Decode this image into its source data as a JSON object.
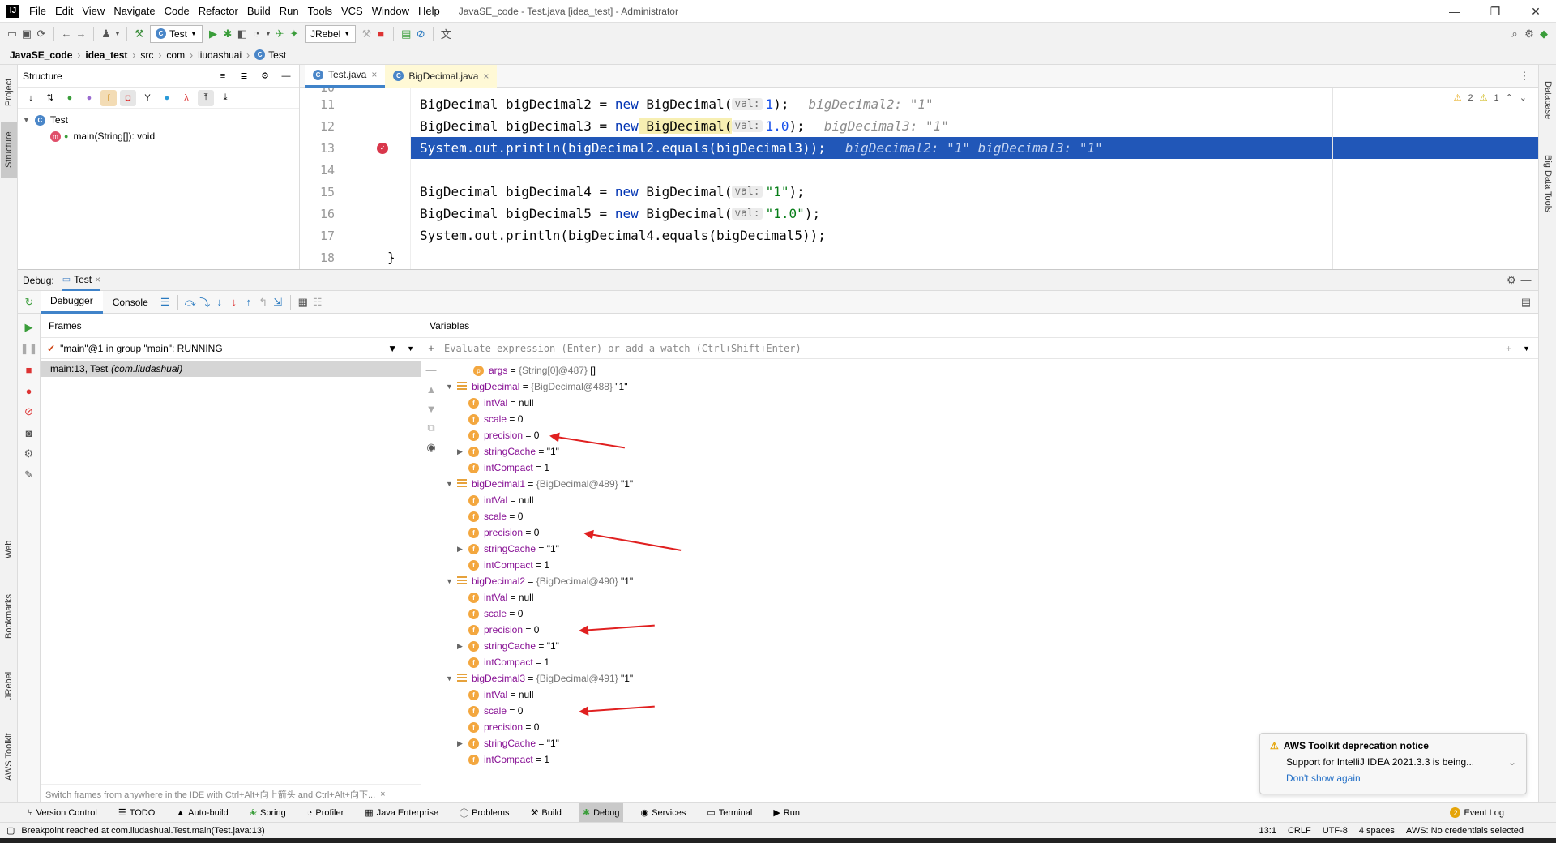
{
  "app": {
    "menu": [
      "File",
      "Edit",
      "View",
      "Navigate",
      "Code",
      "Refactor",
      "Build",
      "Run",
      "Tools",
      "VCS",
      "Window",
      "Help"
    ],
    "title": "JavaSE_code - Test.java [idea_test] - Administrator",
    "win_minimize": "—",
    "win_restore": "❐",
    "win_close": "✕"
  },
  "toolbar": {
    "run_config": "Test",
    "jrebel": "JRebel"
  },
  "navbar": {
    "crumbs": [
      "JavaSE_code",
      "idea_test",
      "src",
      "com",
      "liudashuai",
      "Test"
    ]
  },
  "left_stripe": {
    "project": "Project",
    "structure": "Structure",
    "web": "Web",
    "bookmarks": "Bookmarks",
    "jrebel": "JRebel",
    "aws": "AWS Toolkit"
  },
  "right_stripe": {
    "database": "Database",
    "bigdata": "Big Data Tools"
  },
  "structure": {
    "title": "Structure",
    "class_name": "Test",
    "method": "main(String[]): void"
  },
  "editor": {
    "tabs": [
      "Test.java",
      "BigDecimal.java"
    ],
    "warnings": "2",
    "weak_warnings": "1",
    "lines": [
      {
        "n": "10",
        "text": ""
      },
      {
        "n": "11",
        "a": "BigDecimal bigDecimal2 = ",
        "b": "new",
        "c": " BigDecimal(",
        "hint": "val:",
        "d": "1",
        "e": ");",
        "inline": "bigDecimal2: \"1\""
      },
      {
        "n": "12",
        "a": "BigDecimal bigDecimal3 = ",
        "b": "new",
        "c": " BigDecimal(",
        "hint": "val:",
        "d": "1.0",
        "e": ");",
        "inline": "bigDecimal3: \"1\""
      },
      {
        "n": "13",
        "text": "System.out.println(bigDecimal2.equals(bigDecimal3));",
        "inline": "bigDecimal2: \"1\"   bigDecimal3: \"1\""
      },
      {
        "n": "14",
        "text": ""
      },
      {
        "n": "15",
        "a": "BigDecimal bigDecimal4 = ",
        "b": "new",
        "c": " BigDecimal(",
        "hint": "val:",
        "d": "\"1\"",
        "e": ");"
      },
      {
        "n": "16",
        "a": "BigDecimal bigDecimal5 = ",
        "b": "new",
        "c": " BigDecimal(",
        "hint": "val:",
        "d": "\"1.0\"",
        "e": ");"
      },
      {
        "n": "17",
        "text": "System.out.println(bigDecimal4.equals(bigDecimal5));"
      },
      {
        "n": "18",
        "text": "}"
      }
    ]
  },
  "debug": {
    "label": "Debug:",
    "session": "Test",
    "tab_debugger": "Debugger",
    "tab_console": "Console",
    "frames_title": "Frames",
    "thread": "\"main\"@1 in group \"main\": RUNNING",
    "frame": "main:13, Test",
    "frame_pkg": "(com.liudashuai)",
    "frames_hint": "Switch frames from anywhere in the IDE with Ctrl+Alt+向上箭头 and Ctrl+Alt+向下...",
    "variables_title": "Variables",
    "eval_placeholder": "Evaluate expression (Enter) or add a watch (Ctrl+Shift+Enter)",
    "args": {
      "name": "args",
      "ref": "{String[0]@487}",
      "val": "[]"
    },
    "objects": [
      {
        "name": "bigDecimal",
        "ref": "{BigDecimal@488}",
        "val": "\"1\"",
        "fields": [
          {
            "n": "intVal",
            "v": "null"
          },
          {
            "n": "scale",
            "v": "0"
          },
          {
            "n": "precision",
            "v": "0"
          },
          {
            "n": "stringCache",
            "v": "\"1\""
          },
          {
            "n": "intCompact",
            "v": "1"
          }
        ]
      },
      {
        "name": "bigDecimal1",
        "ref": "{BigDecimal@489}",
        "val": "\"1\"",
        "fields": [
          {
            "n": "intVal",
            "v": "null"
          },
          {
            "n": "scale",
            "v": "0"
          },
          {
            "n": "precision",
            "v": "0"
          },
          {
            "n": "stringCache",
            "v": "\"1\""
          },
          {
            "n": "intCompact",
            "v": "1"
          }
        ]
      },
      {
        "name": "bigDecimal2",
        "ref": "{BigDecimal@490}",
        "val": "\"1\"",
        "fields": [
          {
            "n": "intVal",
            "v": "null"
          },
          {
            "n": "scale",
            "v": "0"
          },
          {
            "n": "precision",
            "v": "0"
          },
          {
            "n": "stringCache",
            "v": "\"1\""
          },
          {
            "n": "intCompact",
            "v": "1"
          }
        ]
      },
      {
        "name": "bigDecimal3",
        "ref": "{BigDecimal@491}",
        "val": "\"1\"",
        "fields": [
          {
            "n": "intVal",
            "v": "null"
          },
          {
            "n": "scale",
            "v": "0"
          },
          {
            "n": "precision",
            "v": "0"
          },
          {
            "n": "stringCache",
            "v": "\"1\""
          },
          {
            "n": "intCompact",
            "v": "1"
          }
        ]
      }
    ]
  },
  "notification": {
    "title": "AWS Toolkit deprecation notice",
    "body": "Support for IntelliJ IDEA 2021.3.3 is being...",
    "link": "Don't show again"
  },
  "bottom_tools": [
    "Version Control",
    "TODO",
    "Auto-build",
    "Spring",
    "Profiler",
    "Java Enterprise",
    "Problems",
    "Build",
    "Debug",
    "Services",
    "Terminal",
    "Run"
  ],
  "event_log": "Event Log",
  "event_count": "2",
  "status": {
    "message": "Breakpoint reached at com.liudashuai.Test.main(Test.java:13)",
    "position": "13:1",
    "line_sep": "CRLF",
    "encoding": "UTF-8",
    "indent": "4 spaces",
    "aws": "AWS: No credentials selected"
  },
  "colors": {
    "selection": "#2157b8",
    "keyword": "#0033b3",
    "field_icon": "#f3a73f",
    "arrow": "#e02020"
  }
}
